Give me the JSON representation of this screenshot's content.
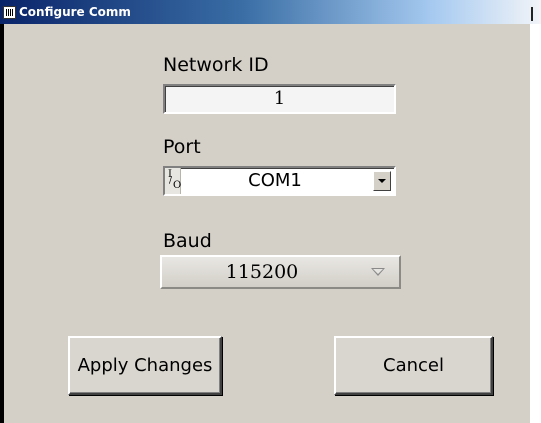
{
  "window": {
    "title": "Configure Comm"
  },
  "network_id": {
    "label": "Network ID",
    "value": "1"
  },
  "port": {
    "label": "Port",
    "value": "COM1",
    "io_icon": {
      "top": "I",
      "bottom": "O"
    }
  },
  "baud": {
    "label": "Baud",
    "value": "115200"
  },
  "buttons": {
    "apply_label": "Apply Changes",
    "cancel_label": "Cancel"
  },
  "colors": {
    "title_start": "#0a246a",
    "title_end": "#a6caf0",
    "panel": "#d4d0c8"
  }
}
